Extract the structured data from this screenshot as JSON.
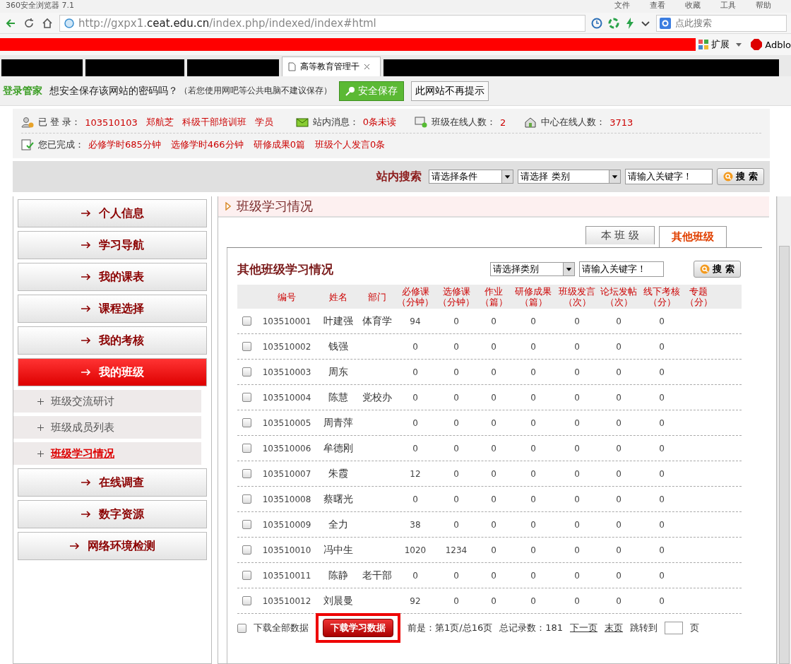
{
  "browser": {
    "title": "360安全浏览器 7.1",
    "menu": [
      "文件",
      "查看",
      "收藏",
      "工具",
      "帮助"
    ],
    "url": {
      "prefix": "http://gxpx1.",
      "host": "ceat.edu.cn",
      "path": "/index.php/indexed/index#html"
    },
    "search_placeholder": "点此搜索",
    "extensions_label": "扩展",
    "adblock_label": "Adblo",
    "tabs": [
      {
        "kind": "redacted",
        "selected": false
      },
      {
        "kind": "redacted",
        "selected": false
      },
      {
        "kind": "redacted",
        "selected": false
      },
      {
        "kind": "page",
        "title": "高等教育管理干",
        "selected": true
      },
      {
        "kind": "redacted",
        "selected": false
      }
    ]
  },
  "password_bar": {
    "brand": "登录管家",
    "question": "想安全保存该网站的密码吗？",
    "note": "（若您使用网吧等公共电脑不建议保存）",
    "save_button": "安全保存",
    "never_button": "此网站不再提示"
  },
  "info": {
    "login": {
      "label": "已 登 录：",
      "values": [
        "103510103",
        "郑航芝",
        "科级干部培训班",
        "学员"
      ]
    },
    "messages": {
      "label": "站内消息：",
      "value": "0条未读"
    },
    "class_online": {
      "label": "班级在线人数：",
      "value": "2"
    },
    "center_online": {
      "label": "中心在线人数：",
      "value": "3713"
    },
    "completed": {
      "label": "您已完成：",
      "items": [
        "必修学时685分钟",
        "选修学时466分钟",
        "研修成果0篇",
        "班级个人发言0条"
      ]
    }
  },
  "site_search": {
    "title": "站内搜索",
    "condition": "请选择条件",
    "category": "请选择 类别",
    "keyword": "请输入关键字！",
    "button": "搜 索"
  },
  "sidebar": {
    "items": [
      {
        "label": "个人信息",
        "selected": false
      },
      {
        "label": "学习导航",
        "selected": false
      },
      {
        "label": "我的课表",
        "selected": false
      },
      {
        "label": "课程选择",
        "selected": false
      },
      {
        "label": "我的考核",
        "selected": false
      },
      {
        "label": "我的班级",
        "selected": true,
        "children": [
          {
            "label": "班级交流研讨",
            "selected": false
          },
          {
            "label": "班级成员列表",
            "selected": false
          },
          {
            "label": "班级学习情况",
            "selected": true
          }
        ]
      },
      {
        "label": "在线调查",
        "selected": false
      },
      {
        "label": "数字资源",
        "selected": false
      },
      {
        "label": "网络环境检测",
        "selected": false
      }
    ]
  },
  "main": {
    "section_title": "班级学习情况",
    "tabs": [
      {
        "label": "本 班 级",
        "selected": false
      },
      {
        "label": "其他班级",
        "selected": true
      }
    ],
    "heading": "其他班级学习情况",
    "filter": {
      "category": "请选择类别",
      "keyword": "请输入关键字！",
      "button": "搜 索"
    },
    "table": {
      "columns": [
        {
          "label": "编号"
        },
        {
          "label": "姓名"
        },
        {
          "label": "部门"
        },
        {
          "label": "必修课",
          "unit": "（分钟）"
        },
        {
          "label": "选修课",
          "unit": "（分钟）"
        },
        {
          "label": "作业",
          "unit": "（篇）"
        },
        {
          "label": "研修成果",
          "unit": "（篇）"
        },
        {
          "label": "班级发言",
          "unit": "（次）"
        },
        {
          "label": "论坛发帖",
          "unit": "（次）"
        },
        {
          "label": "线下考核",
          "unit": "（分）"
        },
        {
          "label": "专题",
          "unit": "（分）"
        }
      ],
      "rows": [
        {
          "checked": false,
          "id": "103510001",
          "name": "叶建强",
          "dept": "体育学",
          "values": [
            "94",
            "0",
            "0",
            "0",
            "0",
            "0",
            "0"
          ]
        },
        {
          "checked": false,
          "id": "103510002",
          "name": "钱强",
          "values": [
            "0",
            "0",
            "0",
            "0",
            "0",
            "0",
            "0"
          ]
        },
        {
          "checked": false,
          "id": "103510003",
          "name": "周东",
          "values": [
            "0",
            "0",
            "0",
            "0",
            "0",
            "0",
            "0"
          ]
        },
        {
          "checked": false,
          "id": "103510004",
          "name": "陈慧",
          "dept": "党校办",
          "values": [
            "0",
            "0",
            "0",
            "0",
            "0",
            "0",
            "0"
          ]
        },
        {
          "checked": false,
          "id": "103510005",
          "name": "周青萍",
          "values": [
            "0",
            "0",
            "0",
            "0",
            "0",
            "0",
            "0"
          ]
        },
        {
          "checked": false,
          "id": "103510006",
          "name": "牟德刚",
          "values": [
            "0",
            "0",
            "0",
            "0",
            "0",
            "0",
            "0"
          ]
        },
        {
          "checked": false,
          "id": "103510007",
          "name": "朱霞",
          "values": [
            "12",
            "0",
            "0",
            "0",
            "0",
            "0",
            "0"
          ]
        },
        {
          "checked": false,
          "id": "103510008",
          "name": "蔡曙光",
          "values": [
            "0",
            "0",
            "0",
            "0",
            "0",
            "0",
            "0"
          ]
        },
        {
          "checked": false,
          "id": "103510009",
          "name": "全力",
          "values": [
            "38",
            "0",
            "0",
            "0",
            "0",
            "0",
            "0"
          ]
        },
        {
          "checked": false,
          "id": "103510010",
          "name": "冯中生",
          "values": [
            "1020",
            "1234",
            "0",
            "0",
            "0",
            "0",
            "0"
          ]
        },
        {
          "checked": false,
          "id": "103510011",
          "name": "陈静",
          "dept": "老干部",
          "values": [
            "0",
            "0",
            "0",
            "0",
            "0",
            "0",
            "0"
          ]
        },
        {
          "checked": false,
          "id": "103510012",
          "name": "刘晨曼",
          "values": [
            "92",
            "0",
            "0",
            "0",
            "0",
            "0",
            "0"
          ]
        }
      ]
    },
    "footer": {
      "download_all": {
        "label": "下载全部数据",
        "checked": false
      },
      "download_button": "下载学习数据",
      "page_info": "前是：第1页/总16页",
      "total": "总记录数：181",
      "next": "下一页",
      "last": "末页",
      "jump": "跳转到",
      "page_unit": "页"
    }
  }
}
